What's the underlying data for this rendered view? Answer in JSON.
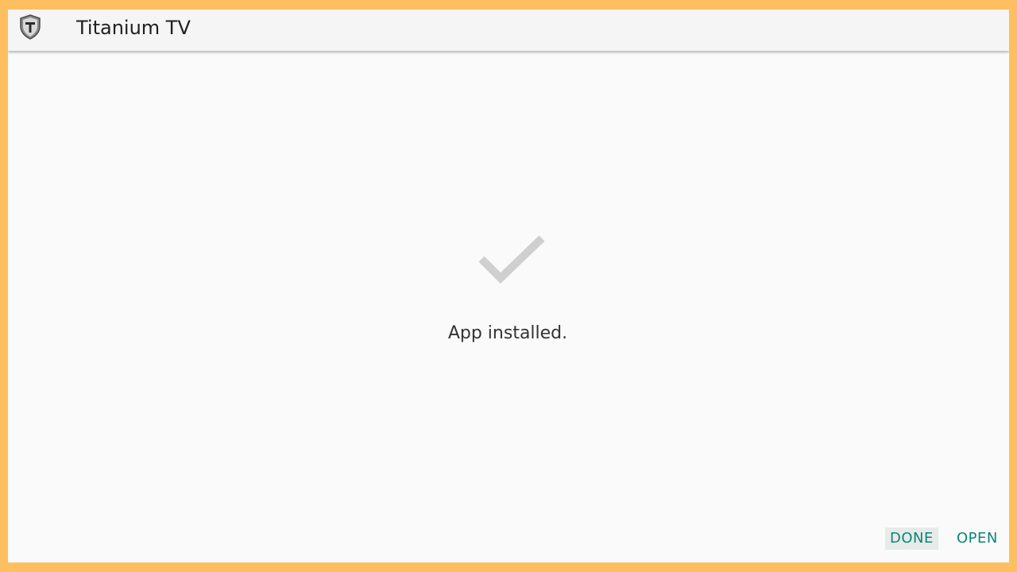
{
  "app_bar": {
    "icon": "titanium-shield-icon",
    "title": "Titanium TV"
  },
  "main": {
    "icon": "checkmark-icon",
    "status": "App installed."
  },
  "actions": {
    "done_label": "DONE",
    "open_label": "OPEN"
  },
  "colors": {
    "accent": "#0e8577",
    "frame_border": "#fdbf60",
    "check": "#cfcfcf",
    "app_bar_bg": "#f5f5f5",
    "page_bg": "#fafafa"
  }
}
